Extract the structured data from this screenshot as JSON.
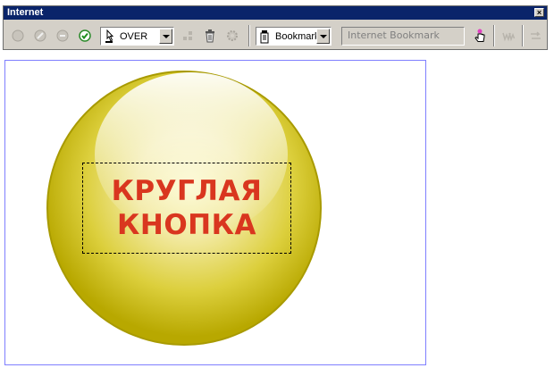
{
  "window": {
    "title": "Internet"
  },
  "toolbar": {
    "state_combo": {
      "value": "OVER"
    },
    "bookmark_combo": {
      "value": "Bookmark"
    },
    "bookmark_name_field": {
      "placeholder": "Internet Bookmark"
    },
    "icons": [
      "back-icon",
      "edit-icon",
      "remove-icon",
      "check-icon",
      "cursor-state-icon",
      "link-icon",
      "trash-icon",
      "settings-icon",
      "bookmark-icon",
      "hand-cursor-icon",
      "www-icon",
      "link-arrow-icon"
    ]
  },
  "stage": {
    "button_text_line1": "КРУГЛАЯ",
    "button_text_line2": "КНОПКА",
    "colors": {
      "sphere_outer": "#b8a800",
      "sphere_inner": "#fbf8c8",
      "text": "#d9361f",
      "frame": "#7f7fff"
    }
  }
}
